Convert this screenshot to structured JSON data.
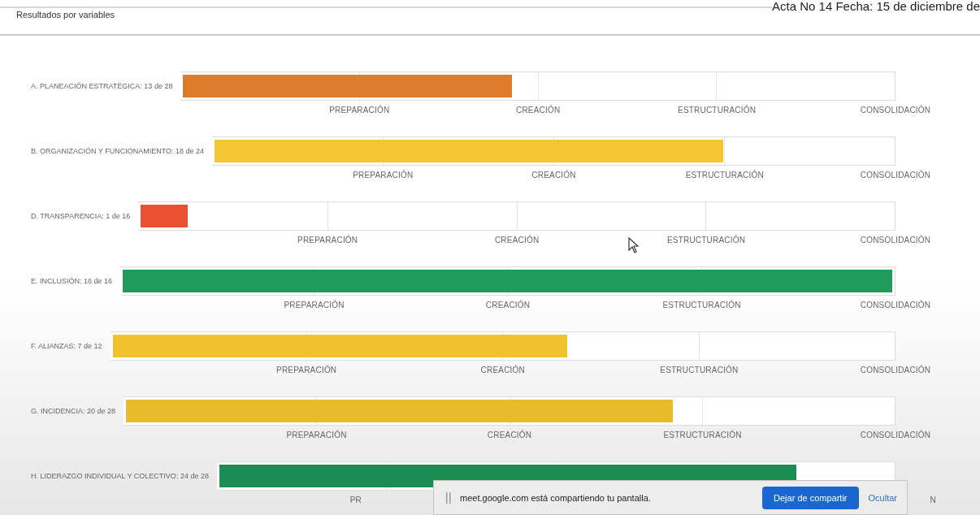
{
  "header": {
    "title": "Resultados por variables",
    "document_note": "Acta No 14 Fecha: 15 de diciembre de"
  },
  "variables": [
    {
      "label": "A. PLANEACIÓN ESTRATÉGICA: 13 de 28",
      "level": 0.464,
      "color": "#e07b2c",
      "kind": "full",
      "axis_labels": [
        "PREPARACIÓN",
        "CREACIÓN",
        "ESTRUCTURACIÓN",
        "CONSOLIDACIÓN"
      ]
    },
    {
      "label": "B. ORGANIZACIÓN Y FUNCIONAMIENTO: 18 de 24",
      "level": 0.75,
      "color": "#f3c531",
      "kind": "full",
      "axis_labels": [
        "PREPARACIÓN",
        "CREACIÓN",
        "ESTRUCTURACIÓN",
        "CONSOLIDACIÓN"
      ]
    },
    {
      "label": "D. TRANSPARENCIA: 1 de 16",
      "level": 0.0625,
      "color": "#ea5133",
      "kind": "full",
      "axis_labels": [
        "PREPARACIÓN",
        "CREACIÓN",
        "ESTRUCTURACIÓN",
        "CONSOLIDACIÓN"
      ]
    },
    {
      "label": "E. INCLUSIÓN: 16 de 16",
      "level": 1,
      "color": "#1f9a5b",
      "kind": "full",
      "axis_labels": [
        "PREPARACIÓN",
        "CREACIÓN",
        "ESTRUCTURACIÓN",
        "CONSOLIDACIÓN"
      ]
    },
    {
      "label": "F. ALIANZAS: 7 de 12",
      "level": 0.583,
      "color": "#f0c22e",
      "kind": "full",
      "axis_labels": [
        "PREPARACIÓN",
        "CREACIÓN",
        "ESTRUCTURACIÓN",
        "CONSOLIDACIÓN"
      ]
    },
    {
      "label": "G. INCIDENCIA: 20 de 28",
      "level": 0.714,
      "color": "#e8bb2f",
      "kind": "full",
      "axis_labels": [
        "PREPARACIÓN",
        "CREACIÓN",
        "ESTRUCTURACIÓN",
        "CONSOLIDACIÓN"
      ]
    },
    {
      "label": "H. LIDERAZGO INDIVIDUAL Y COLECTIVO: 24 de 28",
      "level": 0.857,
      "color": "#1d8c52",
      "kind": "covered",
      "axis_labels": [
        "PR",
        "N"
      ]
    }
  ],
  "share_bar": {
    "message": "meet.google.com está compartiendo tu pantalla.",
    "stop_button": "Dejar de compartir",
    "hide_link": "Ocultar"
  }
}
